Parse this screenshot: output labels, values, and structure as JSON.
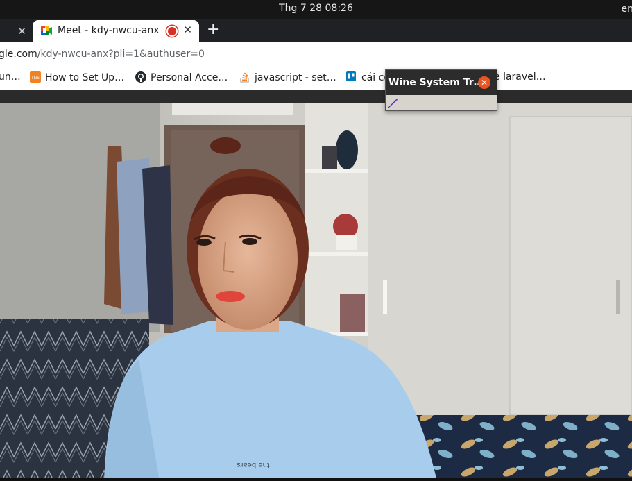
{
  "system_bar": {
    "clock": "Thg 7 28  08:26",
    "language": "en"
  },
  "tabs": {
    "previous_close": "✕",
    "active": {
      "title": "Meet - kdy-nwcu-anx",
      "close": "✕",
      "favicon": "google-meet-icon",
      "recording_indicator": "recording-dot-icon"
    },
    "new_tab": "+"
  },
  "address_bar": {
    "domain": "gle.com",
    "path": "/kdy-nwcu-anx?pli=1&authuser=0"
  },
  "bookmarks": [
    {
      "label": "un…",
      "icon": ""
    },
    {
      "label": "How to Set Up…",
      "icon": "tns-icon"
    },
    {
      "label": "Personal Acce…",
      "icon": "github-icon"
    },
    {
      "label": "javascript - set…",
      "icon": "stackoverflow-icon"
    },
    {
      "label": "cái cố",
      "icon": "trello-icon"
    },
    {
      "label": "e laravel…",
      "icon": ""
    }
  ],
  "wine_popup": {
    "title": "Wine System Tr…",
    "close_icon": "close-icon",
    "tray_icon": "feather-icon"
  },
  "video": {
    "shirt_text": "the bears"
  },
  "colors": {
    "topbar": "#161616",
    "tabstrip": "#202124",
    "ubuntu_orange": "#e95420",
    "record_red": "#d93025"
  }
}
